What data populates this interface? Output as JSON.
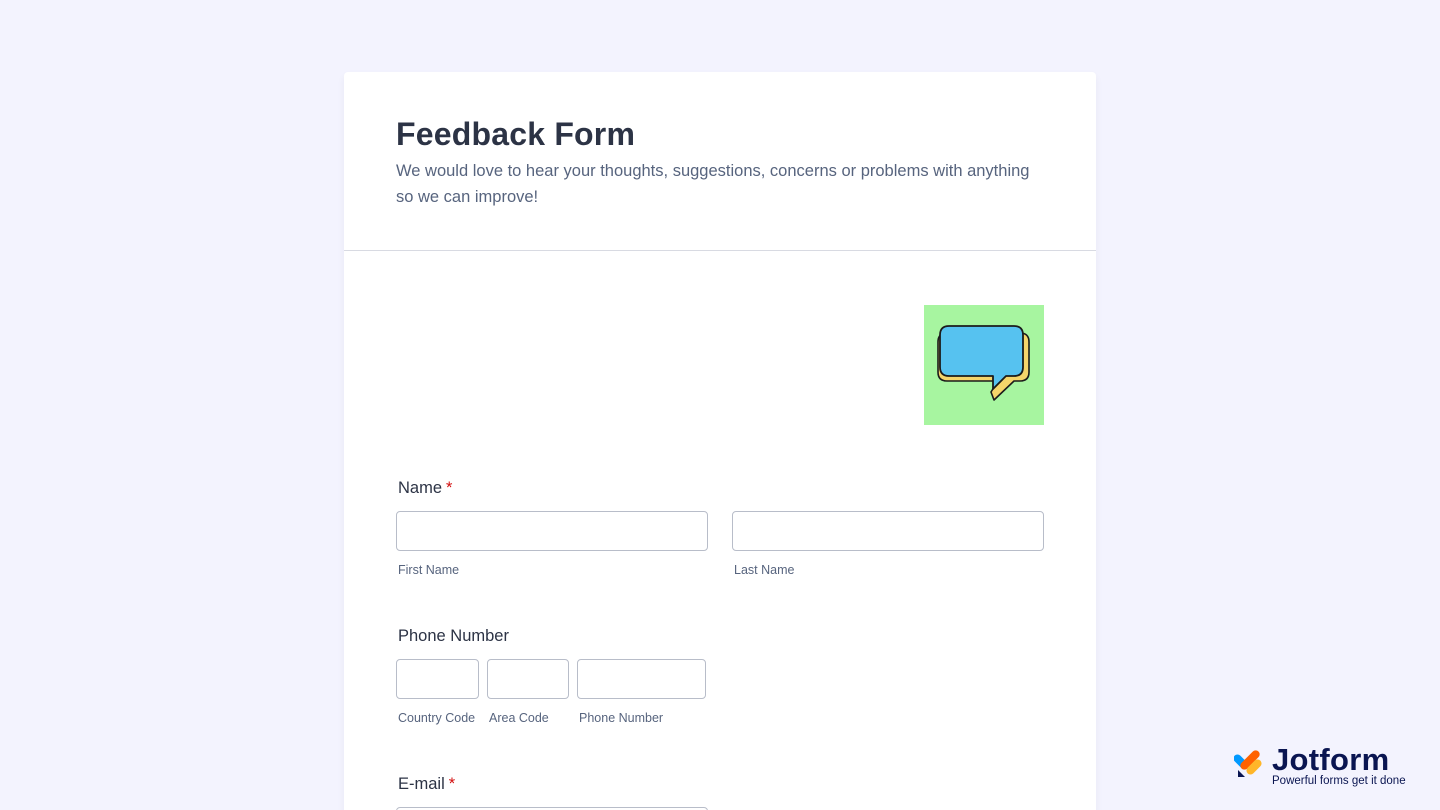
{
  "header": {
    "title": "Feedback Form",
    "subtitle": "We would love to hear your thoughts, suggestions, concerns or problems with anything so we can improve!"
  },
  "name_field": {
    "label": "Name",
    "required_mark": "*",
    "first_sublabel": "First Name",
    "last_sublabel": "Last Name",
    "first_value": "",
    "last_value": ""
  },
  "phone_field": {
    "label": "Phone Number",
    "country_sublabel": "Country Code",
    "area_sublabel": "Area Code",
    "number_sublabel": "Phone Number",
    "country_value": "",
    "area_value": "",
    "number_value": ""
  },
  "email_field": {
    "label": "E-mail",
    "required_mark": "*"
  },
  "image": {
    "icon": "speech-bubble-icon"
  },
  "branding": {
    "name": "Jotform",
    "tagline": "Powerful forms get it done"
  },
  "colors": {
    "page_background": "#f3f3fe",
    "image_background": "#a7f5a0",
    "bubble_blue": "#56c2f0",
    "bubble_yellow": "#f5d56b",
    "required": "#d30d0d",
    "title_text": "#2c3345"
  }
}
